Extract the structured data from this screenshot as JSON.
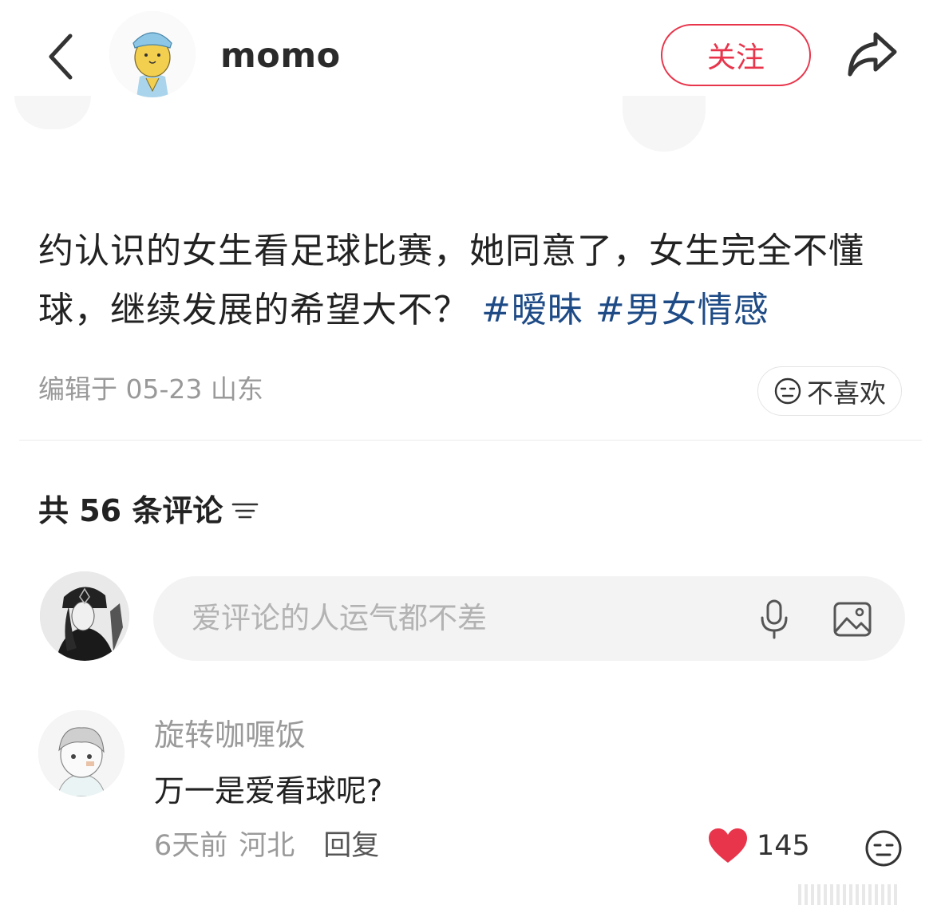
{
  "header": {
    "back_icon": "chevron-left-icon",
    "author_name": "momo",
    "follow_label": "关注",
    "share_icon": "share-arrow-icon",
    "accent_color": "#e8354b"
  },
  "post": {
    "body_text": "约认识的女生看足球比赛，她同意了，女生完全不懂球，继续发展的希望大不？",
    "tags": [
      "#暧昧",
      "#男女情感"
    ],
    "meta": "编辑于 05-23 山东",
    "dislike_label": "不喜欢",
    "tag_color": "#1e4b86"
  },
  "comments_section": {
    "count_label": "共 56 条评论",
    "sort_icon": "sort-lines-icon",
    "input_placeholder": "爱评论的人运气都不差",
    "mic_icon": "microphone-icon",
    "image_icon": "image-icon"
  },
  "comments": [
    {
      "user": "旋转咖喱饭",
      "text": "万一是爱看球呢?",
      "time": "6天前",
      "location": "河北",
      "reply_label": "回复",
      "likes": "145",
      "like_color": "#e8354b"
    }
  ]
}
